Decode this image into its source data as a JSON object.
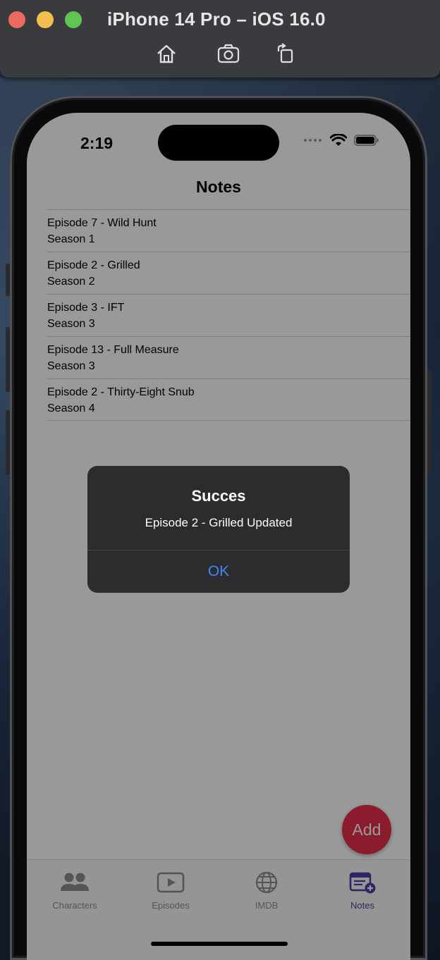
{
  "simulator": {
    "title": "iPhone 14 Pro – iOS 16.0",
    "buttons": [
      "home",
      "screenshot",
      "rotate"
    ]
  },
  "status_bar": {
    "time": "2:19"
  },
  "nav": {
    "title": "Notes"
  },
  "notes": [
    {
      "title": "Episode 7 - Wild Hunt",
      "season": "Season 1"
    },
    {
      "title": "Episode 2 - Grilled",
      "season": "Season 2"
    },
    {
      "title": "Episode 3 - IFT",
      "season": "Season 3"
    },
    {
      "title": "Episode 13 - Full Measure",
      "season": "Season 3"
    },
    {
      "title": "Episode 2 - Thirty-Eight Snub",
      "season": "Season 4"
    }
  ],
  "fab": {
    "label": "Add",
    "color": "#e8304e"
  },
  "tabs": [
    {
      "label": "Characters",
      "icon": "people-icon",
      "active": false
    },
    {
      "label": "Episodes",
      "icon": "play-rectangle-icon",
      "active": false
    },
    {
      "label": "IMDB",
      "icon": "globe-icon",
      "active": false
    },
    {
      "label": "Notes",
      "icon": "notes-add-icon",
      "active": true
    }
  ],
  "alert": {
    "title": "Succes",
    "message": "Episode 2 - Grilled Updated",
    "button": "OK"
  },
  "colors": {
    "accent": "#4b3ea8",
    "alert_button": "#3b8bf7"
  }
}
